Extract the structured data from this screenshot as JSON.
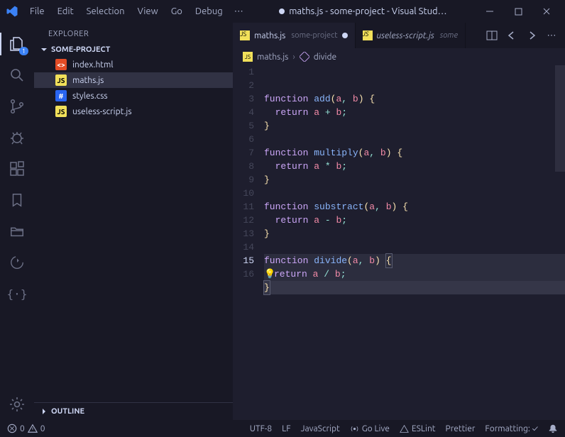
{
  "titlebar": {
    "menu": [
      "File",
      "Edit",
      "Selection",
      "View",
      "Go",
      "Debug"
    ],
    "title": "maths.js - some-project - Visual Stud…"
  },
  "activitybar": {
    "explorer_badge": "1"
  },
  "sidebar": {
    "title": "EXPLORER",
    "project": "SOME-PROJECT",
    "files": [
      {
        "name": "index.html",
        "icon": "html",
        "glyph": "<>"
      },
      {
        "name": "maths.js",
        "icon": "js",
        "glyph": "JS",
        "selected": true
      },
      {
        "name": "styles.css",
        "icon": "css",
        "glyph": "#"
      },
      {
        "name": "useless-script.js",
        "icon": "js",
        "glyph": "JS"
      }
    ],
    "outline": "OUTLINE"
  },
  "tabs": {
    "items": [
      {
        "file": "maths.js",
        "project": "some-project",
        "dirty": true,
        "active": true
      },
      {
        "file": "useless-script.js",
        "project": "some",
        "dirty": false,
        "active": false,
        "italic": true
      }
    ]
  },
  "breadcrumb": {
    "file": "maths.js",
    "symbol": "divide"
  },
  "editor": {
    "current_line": 15,
    "lines": [
      {
        "n": 1,
        "tokens": [
          [
            "kw",
            "function"
          ],
          [
            "",
            " "
          ],
          [
            "fn",
            "add"
          ],
          [
            "br0",
            "("
          ],
          [
            "pn",
            "a"
          ],
          [
            "op",
            ","
          ],
          [
            "",
            " "
          ],
          [
            "pn",
            "b"
          ],
          [
            "br0",
            ")"
          ],
          [
            "",
            " "
          ],
          [
            "br0",
            "{"
          ]
        ]
      },
      {
        "n": 2,
        "tokens": [
          [
            "",
            "  "
          ],
          [
            "kw",
            "return"
          ],
          [
            "",
            " "
          ],
          [
            "pn",
            "a"
          ],
          [
            "",
            " "
          ],
          [
            "op",
            "+"
          ],
          [
            "",
            " "
          ],
          [
            "pn",
            "b"
          ],
          [
            "op",
            ";"
          ]
        ]
      },
      {
        "n": 3,
        "tokens": [
          [
            "br0",
            "}"
          ]
        ]
      },
      {
        "n": 4,
        "tokens": []
      },
      {
        "n": 5,
        "tokens": [
          [
            "kw",
            "function"
          ],
          [
            "",
            " "
          ],
          [
            "fn",
            "multiply"
          ],
          [
            "br0",
            "("
          ],
          [
            "pn",
            "a"
          ],
          [
            "op",
            ","
          ],
          [
            "",
            " "
          ],
          [
            "pn",
            "b"
          ],
          [
            "br0",
            ")"
          ],
          [
            "",
            " "
          ],
          [
            "br0",
            "{"
          ]
        ]
      },
      {
        "n": 6,
        "tokens": [
          [
            "",
            "  "
          ],
          [
            "kw",
            "return"
          ],
          [
            "",
            " "
          ],
          [
            "pn",
            "a"
          ],
          [
            "",
            " "
          ],
          [
            "op",
            "*"
          ],
          [
            "",
            " "
          ],
          [
            "pn",
            "b"
          ],
          [
            "op",
            ";"
          ]
        ]
      },
      {
        "n": 7,
        "tokens": [
          [
            "br0",
            "}"
          ]
        ]
      },
      {
        "n": 8,
        "tokens": []
      },
      {
        "n": 9,
        "tokens": [
          [
            "kw",
            "function"
          ],
          [
            "",
            " "
          ],
          [
            "fn",
            "substract"
          ],
          [
            "br0",
            "("
          ],
          [
            "pn",
            "a"
          ],
          [
            "op",
            ","
          ],
          [
            "",
            " "
          ],
          [
            "pn",
            "b"
          ],
          [
            "br0",
            ")"
          ],
          [
            "",
            " "
          ],
          [
            "br0",
            "{"
          ]
        ]
      },
      {
        "n": 10,
        "tokens": [
          [
            "",
            "  "
          ],
          [
            "kw",
            "return"
          ],
          [
            "",
            " "
          ],
          [
            "pn",
            "a"
          ],
          [
            "",
            " "
          ],
          [
            "op",
            "-"
          ],
          [
            "",
            " "
          ],
          [
            "pn",
            "b"
          ],
          [
            "op",
            ";"
          ]
        ]
      },
      {
        "n": 11,
        "tokens": [
          [
            "br0",
            "}"
          ]
        ]
      },
      {
        "n": 12,
        "tokens": []
      },
      {
        "n": 13,
        "hl": true,
        "tokens": [
          [
            "kw",
            "function"
          ],
          [
            "",
            " "
          ],
          [
            "fn",
            "divide"
          ],
          [
            "br0",
            "("
          ],
          [
            "pn",
            "a"
          ],
          [
            "op",
            ","
          ],
          [
            "",
            " "
          ],
          [
            "pn",
            "b"
          ],
          [
            "br0",
            ")"
          ],
          [
            "",
            " "
          ],
          [
            "br0",
            "{"
          ]
        ],
        "box_last": true
      },
      {
        "n": 14,
        "hl": true,
        "bulb": true,
        "tokens": [
          [
            "kw",
            "return"
          ],
          [
            "",
            " "
          ],
          [
            "pn",
            "a"
          ],
          [
            "",
            " "
          ],
          [
            "op",
            "/"
          ],
          [
            "",
            " "
          ],
          [
            "pn",
            "b"
          ],
          [
            "op",
            ";"
          ]
        ]
      },
      {
        "n": 15,
        "hl2": true,
        "tokens": [
          [
            "br0",
            "}"
          ]
        ],
        "cursor_after": true,
        "box_first": true
      },
      {
        "n": 16,
        "tokens": []
      }
    ]
  },
  "statusbar": {
    "errors": "0",
    "warnings": "0",
    "encoding": "UTF-8",
    "eol": "LF",
    "language": "JavaScript",
    "golive": "Go Live",
    "eslint": "ESLint",
    "prettier": "Prettier",
    "formatting": "Formatting: ✓"
  }
}
